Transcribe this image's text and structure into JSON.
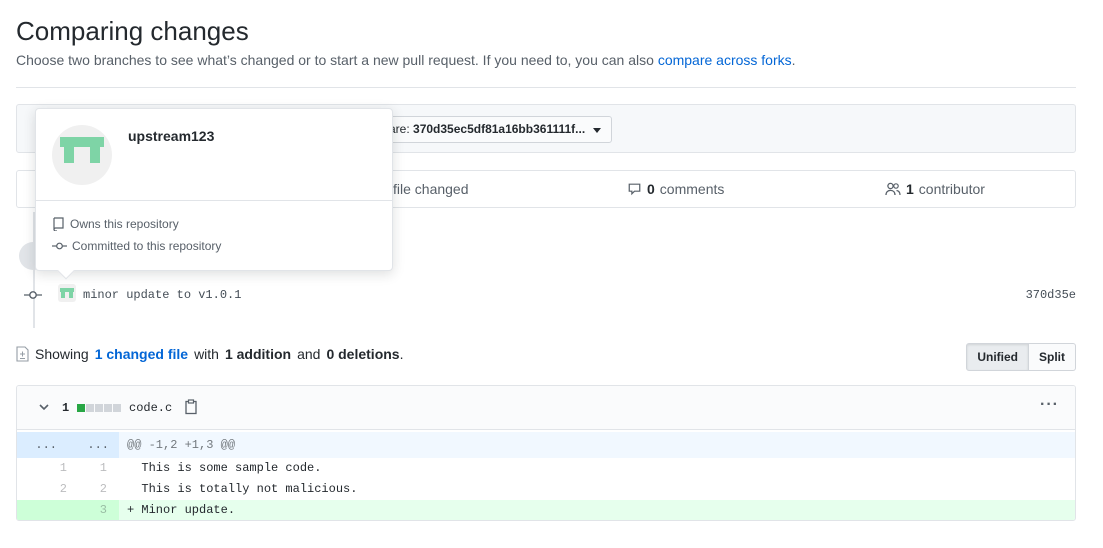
{
  "page": {
    "title": "Comparing changes",
    "subtitle_text": "Choose two branches to see what’s changed or to start a new pull request. If you need to, you can also ",
    "subtitle_link": "compare across forks",
    "subtitle_end": "."
  },
  "range": {
    "compare_prefix": "are: ",
    "compare_value": "370d35ec5df81a16bb361111f..."
  },
  "stats": {
    "files_label": "file changed",
    "comments_count": "0",
    "comments_label": "comments",
    "contributors_count": "1",
    "contributors_label": "contributor"
  },
  "commit": {
    "message": "minor update to v1.0.1",
    "sha": "370d35e"
  },
  "summary": {
    "prefix": "Showing",
    "link": "1 changed file",
    "with": "with",
    "additions": "1 addition",
    "and": "and",
    "deletions": "0 deletions",
    "end": "."
  },
  "view_toggle": {
    "unified": "Unified",
    "split": "Split",
    "selected": "Unified"
  },
  "file": {
    "changes": "1",
    "name": "code.c",
    "diffstat": [
      "add",
      "neutral",
      "neutral",
      "neutral",
      "neutral"
    ],
    "more": "···"
  },
  "diff": {
    "hunk_left": "...",
    "hunk_right": "...",
    "hunk_header": "@@ -1,2 +1,3 @@",
    "lines": [
      {
        "old": "1",
        "new": "1",
        "text": "  This is some sample code."
      },
      {
        "old": "2",
        "new": "2",
        "text": "  This is totally not malicious."
      },
      {
        "old": "",
        "new": "3",
        "text": "+ Minor update."
      }
    ]
  },
  "popover": {
    "username": "upstream123",
    "owns": "Owns this repository",
    "committed": "Committed to this repository"
  },
  "colors": {
    "link": "#0366d6",
    "add_bg": "#e6ffed",
    "add_gutter": "#cdffd8",
    "hunk_bg": "#f1f8ff",
    "diffstat_add": "#28a745",
    "diffstat_neutral": "#d1d5da",
    "avatar_green": "#7ed4a6"
  }
}
